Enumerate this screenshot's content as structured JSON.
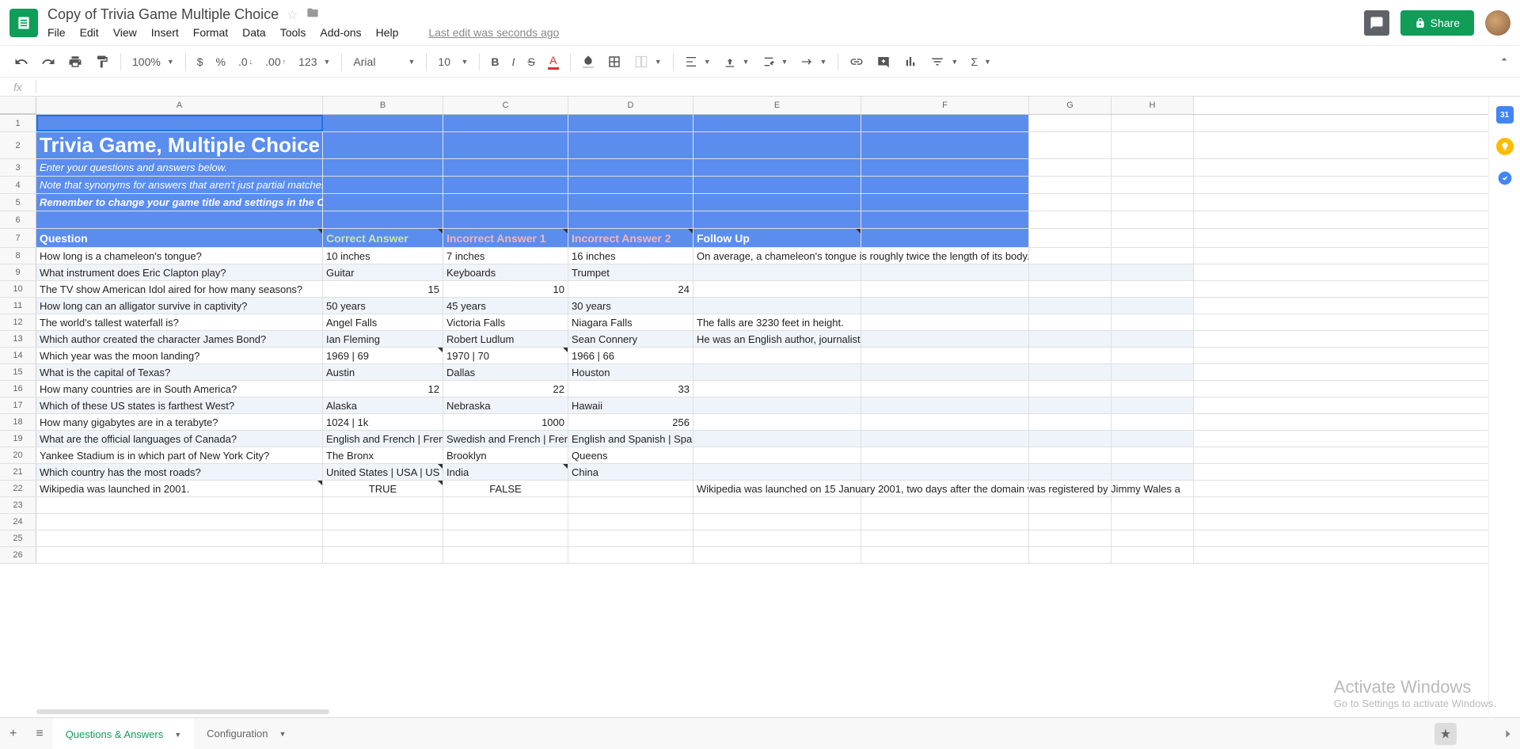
{
  "doc": {
    "title": "Copy of Trivia Game Multiple Choice",
    "last_edit": "Last edit was seconds ago"
  },
  "menus": [
    "File",
    "Edit",
    "View",
    "Insert",
    "Format",
    "Data",
    "Tools",
    "Add-ons",
    "Help"
  ],
  "share": "Share",
  "toolbar": {
    "zoom": "100%",
    "font": "Arial",
    "size": "10",
    "more_formats": "123"
  },
  "columns": [
    "A",
    "B",
    "C",
    "D",
    "E",
    "F",
    "G",
    "H"
  ],
  "title_text": "Trivia Game, Multiple Choice",
  "instructions": [
    "Enter your questions and answers below.",
    "Note that synonyms for answers that aren't just partial matches can be separated with the '|' character.",
    "Remember to change your game title and settings in the Configuration tab."
  ],
  "table_headers": {
    "question": "Question",
    "correct": "Correct Answer",
    "incorrect1": "Incorrect Answer 1",
    "incorrect2": "Incorrect Answer 2",
    "followup": "Follow Up"
  },
  "rows": [
    {
      "q": "How long is a chameleon's tongue?",
      "c": "10 inches",
      "i1": "7 inches",
      "i2": "16 inches",
      "f": "On average, a chameleon's tongue is roughly twice the length of its body."
    },
    {
      "q": "What instrument does Eric Clapton play?",
      "c": "Guitar",
      "i1": "Keyboards",
      "i2": "Trumpet",
      "f": ""
    },
    {
      "q": "The TV show American Idol aired for how many seasons?",
      "c": "15",
      "i1": "10",
      "i2": "24",
      "f": "",
      "num": true
    },
    {
      "q": "How long can an alligator survive in captivity?",
      "c": "50 years",
      "i1": "45 years",
      "i2": "30 years",
      "f": ""
    },
    {
      "q": "The world's tallest waterfall is?",
      "c": "Angel Falls",
      "i1": "Victoria Falls",
      "i2": "Niagara Falls",
      "f": "The falls are 3230 feet in height."
    },
    {
      "q": "Which author created the character James Bond?",
      "c": "Ian Fleming",
      "i1": "Robert Ludlum",
      "i2": "Sean Connery",
      "f": "He was an English author, journalist and naval intelligence officer."
    },
    {
      "q": "Which year was the moon landing?",
      "c": "1969 | 69",
      "i1": "1970 | 70",
      "i2": "1966 | 66",
      "f": ""
    },
    {
      "q": "What is the capital of Texas?",
      "c": "Austin",
      "i1": "Dallas",
      "i2": "Houston",
      "f": ""
    },
    {
      "q": "How many countries are in South America?",
      "c": "12",
      "i1": "22",
      "i2": "33",
      "f": "",
      "num": true
    },
    {
      "q": "Which of these US states is farthest West?",
      "c": "Alaska",
      "i1": "Nebraska",
      "i2": "Hawaii",
      "f": ""
    },
    {
      "q": "How many gigabytes are in a terabyte?",
      "c": "1024 | 1k",
      "i1": "1000",
      "i2": "256",
      "f": "",
      "numI": true
    },
    {
      "q": "What are the official languages of Canada?",
      "c": "English and French | French",
      "i1": "Swedish and French | French",
      "i2": "English and Spanish | Spanish and English",
      "f": ""
    },
    {
      "q": "Yankee Stadium is in which part of New York City?",
      "c": "The Bronx",
      "i1": "Brooklyn",
      "i2": "Queens",
      "f": ""
    },
    {
      "q": "Which country has the most roads?",
      "c": "United States | USA | US",
      "i1": "India",
      "i2": "China",
      "f": ""
    },
    {
      "q": "Wikipedia was launched in 2001.",
      "c": "TRUE",
      "i1": "FALSE",
      "i2": "",
      "f": "Wikipedia was launched on 15 January 2001, two days after the domain was registered by Jimmy Wales a",
      "center": true
    }
  ],
  "tabs": {
    "active": "Questions & Answers",
    "other": "Configuration"
  },
  "watermark": {
    "title": "Activate Windows",
    "sub": "Go to Settings to activate Windows."
  }
}
